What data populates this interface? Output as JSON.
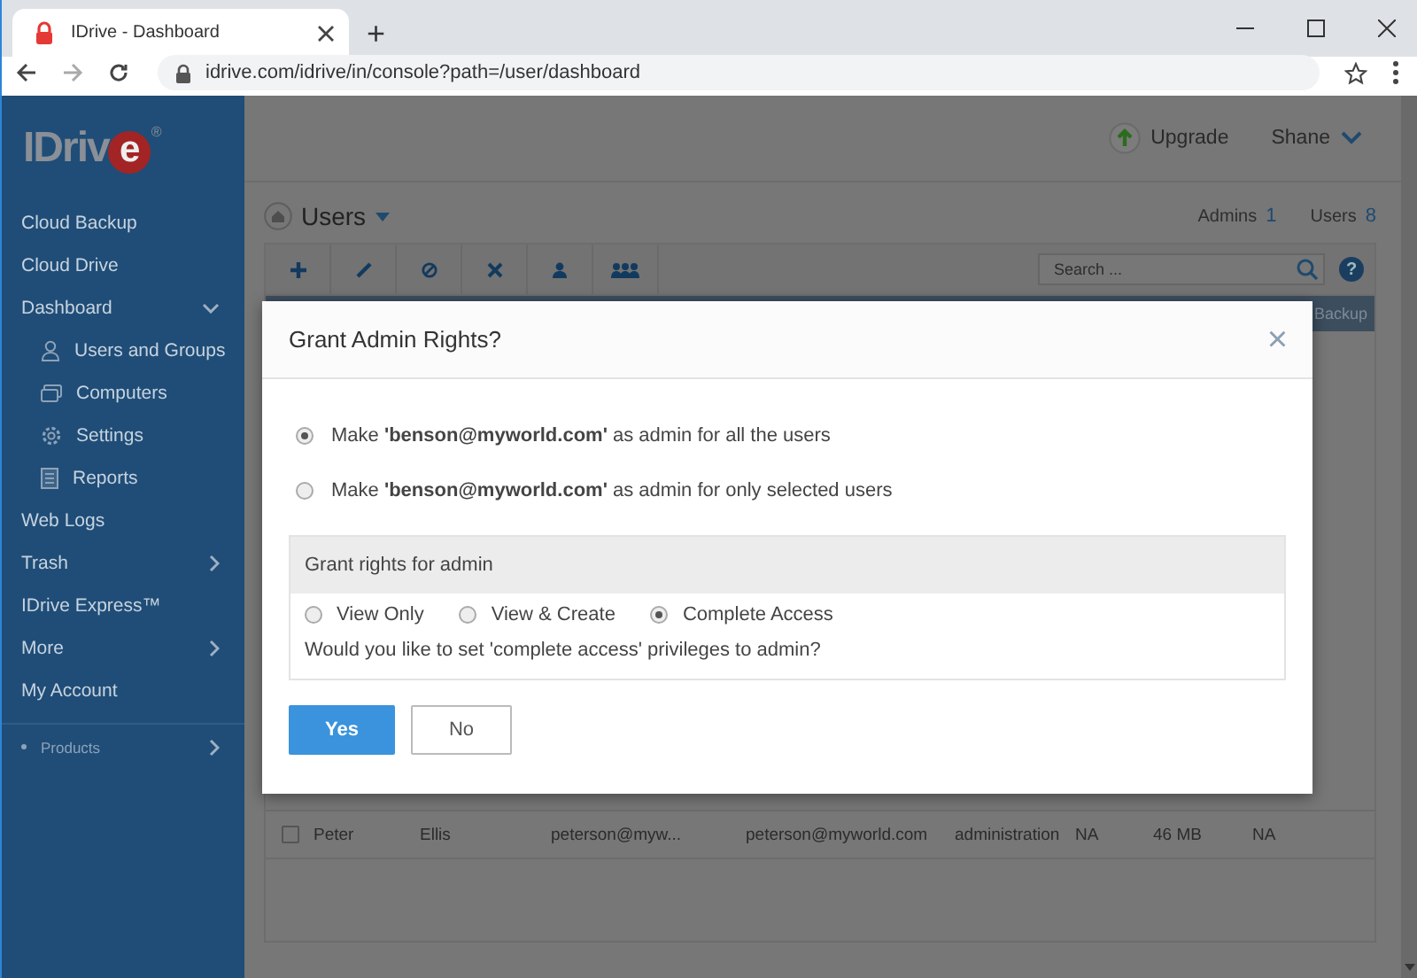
{
  "browser": {
    "tab_title": "IDrive - Dashboard",
    "new_tab": "+",
    "address": "idrive.com/idrive/in/console?path=/user/dashboard"
  },
  "sidebar": {
    "logo": "IDriv",
    "logo_e": "e",
    "logo_mark": "®",
    "items": [
      {
        "label": "Cloud Backup",
        "kind": "plain"
      },
      {
        "label": "Cloud Drive",
        "kind": "plain"
      },
      {
        "label": "Dashboard",
        "kind": "expanded"
      },
      {
        "label": "Users and Groups",
        "kind": "sub"
      },
      {
        "label": "Computers",
        "kind": "sub"
      },
      {
        "label": "Settings",
        "kind": "sub"
      },
      {
        "label": "Reports",
        "kind": "sub"
      },
      {
        "label": "Web Logs",
        "kind": "plain"
      },
      {
        "label": "Trash",
        "kind": "collapsed"
      },
      {
        "label": "IDrive Express™",
        "kind": "plain"
      },
      {
        "label": "More",
        "kind": "collapsed"
      },
      {
        "label": "My Account",
        "kind": "plain"
      }
    ],
    "products": "Products"
  },
  "header": {
    "upgrade": "Upgrade",
    "user": "Shane"
  },
  "page": {
    "title": "Users",
    "admins_label": "Admins",
    "admins": "1",
    "users_label": "Users",
    "users": "8",
    "search_placeholder": "Search ...",
    "help": "?"
  },
  "table": {
    "header_tail": "Backup",
    "rows": [
      {
        "checked": false,
        "cells": [
          "Peter",
          "Ellis",
          "peterson@myw...",
          "peterson@myworld.com",
          "administration",
          "NA",
          "46 MB",
          "NA"
        ]
      }
    ]
  },
  "dialog": {
    "title": "Grant Admin Rights?",
    "close": "×",
    "scope_options": [
      {
        "text": "Make **'benson@myworld.com'** as admin for all the users",
        "selected": true
      },
      {
        "text": "Make **'benson@myworld.com'** as admin for only selected users",
        "selected": false
      }
    ],
    "rights": {
      "heading": "Grant rights for admin",
      "options": [
        {
          "label": "View Only",
          "selected": false
        },
        {
          "label": "View & Create",
          "selected": false
        },
        {
          "label": "Complete Access",
          "selected": true
        }
      ],
      "question": "Would you like to set 'complete access' privileges to admin?"
    },
    "buttons": [
      {
        "label": "Yes",
        "kind": "primary"
      },
      {
        "label": "No",
        "kind": "secondary"
      }
    ]
  }
}
